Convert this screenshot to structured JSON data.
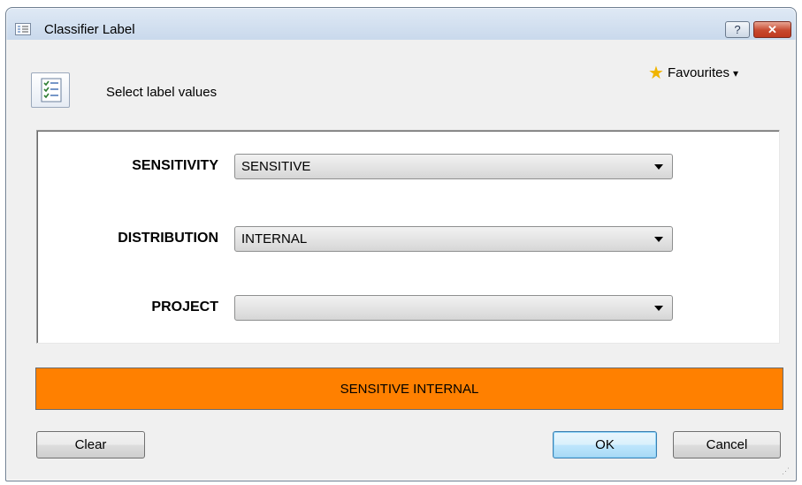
{
  "window": {
    "title": "Classifier Label",
    "help_glyph": "?",
    "close_glyph": "✕"
  },
  "header": {
    "instruction": "Select label values",
    "favourites_label": "Favourites",
    "favourites_arrow": "▾",
    "favourites_icon": "star-icon"
  },
  "fields": [
    {
      "label": "SENSITIVITY",
      "value": "SENSITIVE"
    },
    {
      "label": "DISTRIBUTION",
      "value": "INTERNAL"
    },
    {
      "label": "PROJECT",
      "value": ""
    }
  ],
  "banner": {
    "text": "SENSITIVE INTERNAL",
    "color": "#ff8000"
  },
  "buttons": {
    "clear": "Clear",
    "ok": "OK",
    "cancel": "Cancel"
  }
}
